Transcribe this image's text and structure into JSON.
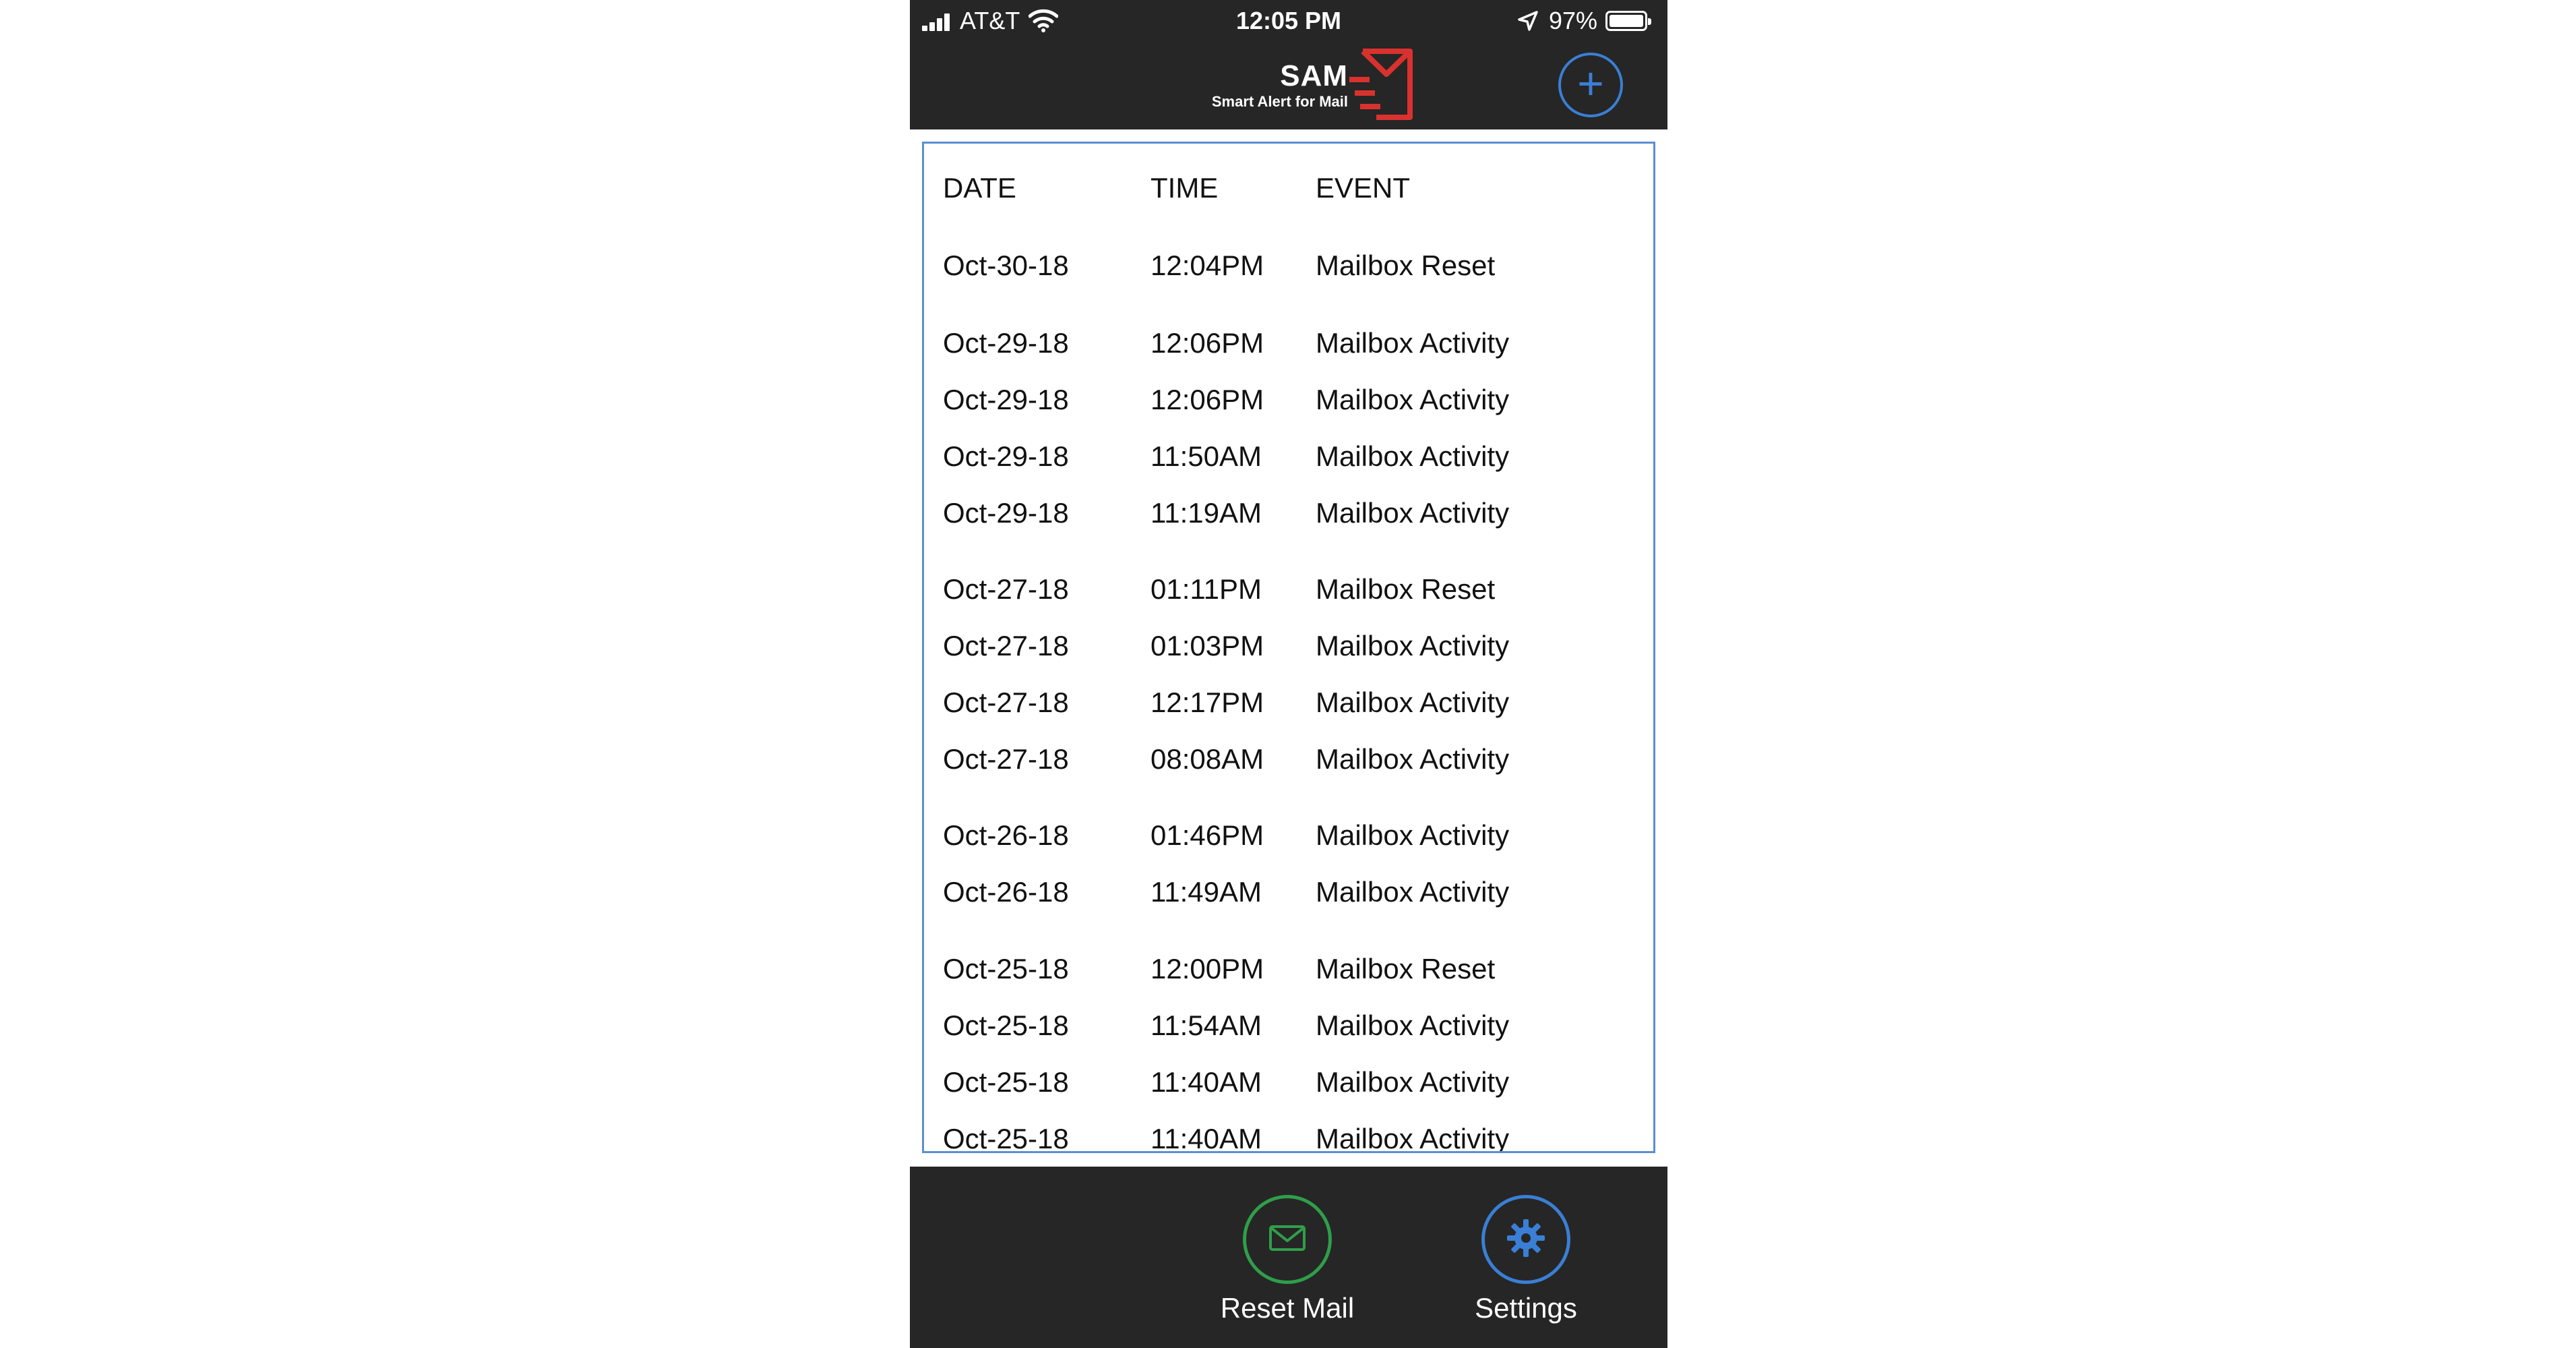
{
  "status_bar": {
    "carrier": "AT&T",
    "time": "12:05 PM",
    "battery": "97%"
  },
  "header": {
    "logo_title": "SAM",
    "logo_subtitle": "Smart Alert for Mail",
    "add_button": "+",
    "colors": {
      "background": "#262626",
      "accent": "#3a7fd5",
      "brand_red": "#d9322e"
    }
  },
  "log": {
    "columns": [
      "DATE",
      "TIME",
      "EVENT"
    ],
    "rows": [
      {
        "date": "Oct-30-18",
        "time": "12:04PM",
        "event": "Mailbox Reset"
      },
      {
        "date": "Oct-29-18",
        "time": "12:06PM",
        "event": "Mailbox Activity"
      },
      {
        "date": "Oct-29-18",
        "time": "12:06PM",
        "event": "Mailbox Activity"
      },
      {
        "date": "Oct-29-18",
        "time": "11:50AM",
        "event": "Mailbox Activity"
      },
      {
        "date": "Oct-29-18",
        "time": "11:19AM",
        "event": "Mailbox Activity"
      },
      {
        "date": "Oct-27-18",
        "time": "01:11PM",
        "event": "Mailbox Reset"
      },
      {
        "date": "Oct-27-18",
        "time": "01:03PM",
        "event": "Mailbox Activity"
      },
      {
        "date": "Oct-27-18",
        "time": "12:17PM",
        "event": "Mailbox Activity"
      },
      {
        "date": "Oct-27-18",
        "time": "08:08AM",
        "event": "Mailbox Activity"
      },
      {
        "date": "Oct-26-18",
        "time": "01:46PM",
        "event": "Mailbox Activity"
      },
      {
        "date": "Oct-26-18",
        "time": "11:49AM",
        "event": "Mailbox Activity"
      },
      {
        "date": "Oct-25-18",
        "time": "12:00PM",
        "event": "Mailbox Reset"
      },
      {
        "date": "Oct-25-18",
        "time": "11:54AM",
        "event": "Mailbox Activity"
      },
      {
        "date": "Oct-25-18",
        "time": "11:40AM",
        "event": "Mailbox Activity"
      },
      {
        "date": "Oct-25-18",
        "time": "11:40AM",
        "event": "Mailbox Activity"
      }
    ]
  },
  "bottom_bar": {
    "reset_label": "Reset Mail",
    "settings_label": "Settings",
    "reset_color": "#2f9e4a",
    "settings_color": "#3a7fd5"
  }
}
